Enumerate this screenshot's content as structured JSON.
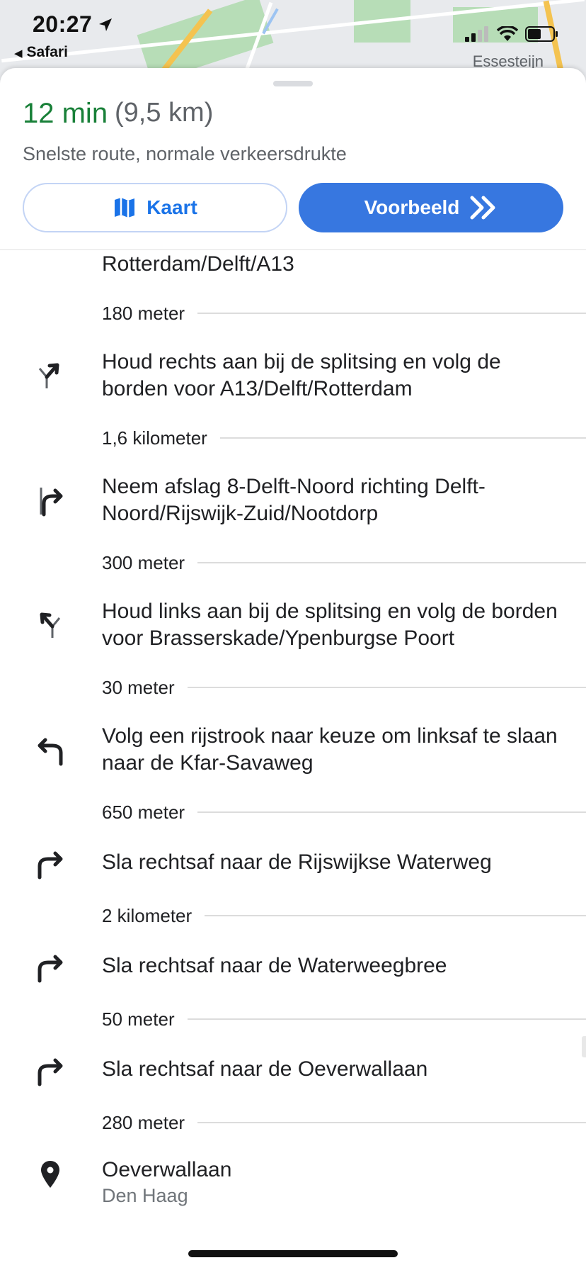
{
  "status_bar": {
    "time": "20:27",
    "back_app": "Safari",
    "map_label": "Essesteijn"
  },
  "summary": {
    "duration": "12 min",
    "distance": "(9,5 km)",
    "description": "Snelste route, normale verkeersdrukte",
    "accent_color": "#188038"
  },
  "buttons": {
    "map_label": "Kaart",
    "preview_label": "Voorbeeld",
    "primary_color": "#3777e0"
  },
  "steps": [
    {
      "text": "Rotterdam/Delft/A13",
      "icon": "",
      "distance": "180 meter"
    },
    {
      "text": "Houd rechts aan bij de splitsing en volg de borden voor A13/Delft/Rotterdam",
      "icon": "fork-right-icon",
      "distance": "1,6 kilometer"
    },
    {
      "text": "Neem afslag 8-Delft-Noord richting Delft-Noord/Rijswijk-Zuid/Nootdorp",
      "icon": "exit-right-icon",
      "distance": "300 meter"
    },
    {
      "text": "Houd links aan bij de splitsing en volg de borden voor Brasserskade/Ypenburgse Poort",
      "icon": "fork-left-icon",
      "distance": "30 meter"
    },
    {
      "text": "Volg een rijstrook naar keuze om linksaf te slaan naar de Kfar-Savaweg",
      "icon": "turn-left-icon",
      "distance": "650 meter"
    },
    {
      "text": "Sla rechtsaf naar de Rijswijkse Waterweg",
      "icon": "turn-right-icon",
      "distance": "2 kilometer"
    },
    {
      "text": "Sla rechtsaf naar de Waterweegbree",
      "icon": "turn-right-icon",
      "distance": "50 meter"
    },
    {
      "text": "Sla rechtsaf naar de Oeverwallaan",
      "icon": "turn-right-icon",
      "distance": "280 meter"
    }
  ],
  "destination": {
    "name": "Oeverwallaan",
    "city": "Den Haag",
    "icon": "location-pin-icon"
  }
}
